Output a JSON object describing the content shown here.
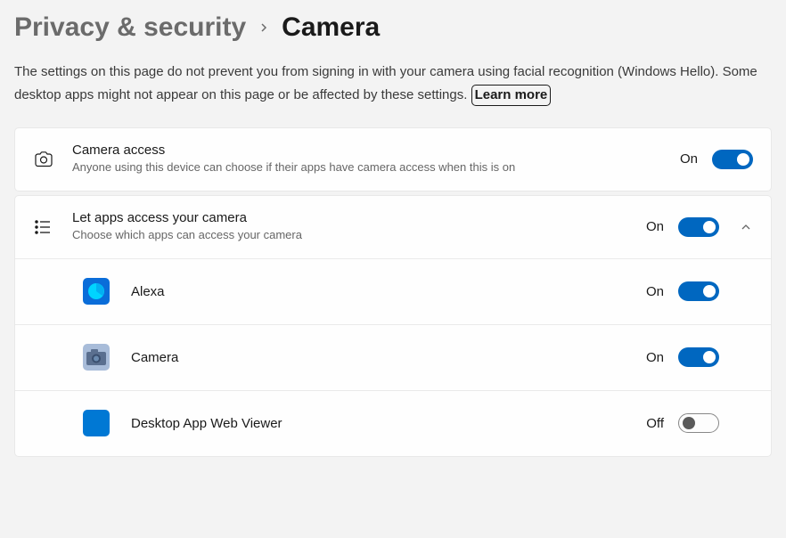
{
  "breadcrumb": {
    "parent": "Privacy & security",
    "current": "Camera"
  },
  "description": "The settings on this page do not prevent you from signing in with your camera using facial recognition (Windows Hello). Some desktop apps might not appear on this page or be affected by these settings.",
  "learnMore": "Learn more",
  "labels": {
    "on": "On",
    "off": "Off"
  },
  "settings": {
    "cameraAccess": {
      "title": "Camera access",
      "subtitle": "Anyone using this device can choose if their apps have camera access when this is on",
      "state": "on"
    },
    "letAppsAccess": {
      "title": "Let apps access your camera",
      "subtitle": "Choose which apps can access your camera",
      "state": "on",
      "expanded": true
    }
  },
  "apps": [
    {
      "name": "Alexa",
      "state": "on",
      "iconBg": "#0a6dd9",
      "iconType": "alexa"
    },
    {
      "name": "Camera",
      "state": "on",
      "iconBg": "#9cb3d6",
      "iconType": "camera"
    },
    {
      "name": "Desktop App Web Viewer",
      "state": "off",
      "iconBg": "#0078d4",
      "iconType": "blank"
    }
  ]
}
